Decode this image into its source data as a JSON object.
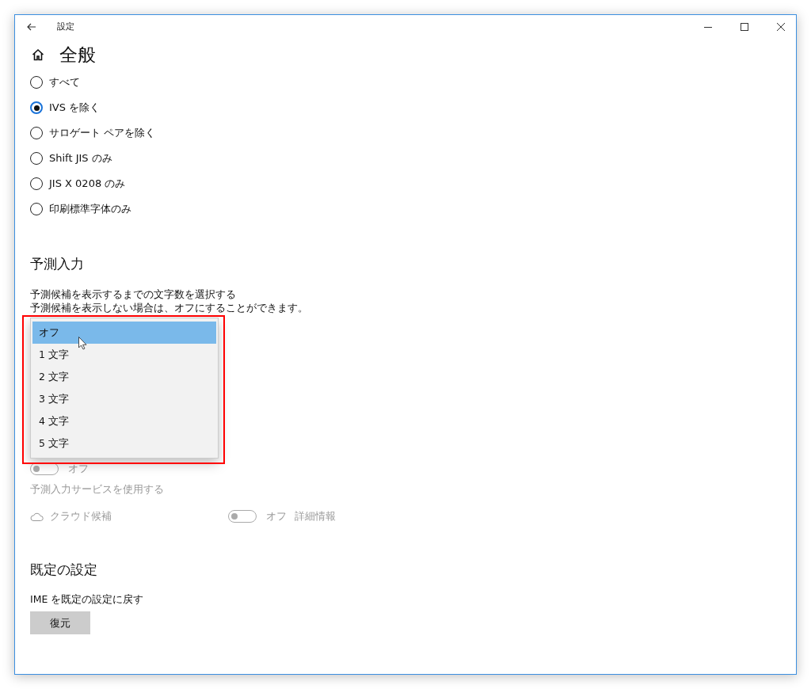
{
  "window": {
    "title": "設定"
  },
  "page": {
    "title": "全般"
  },
  "radio_options": [
    {
      "label": "すべて",
      "selected": false
    },
    {
      "label": "IVS を除く",
      "selected": true
    },
    {
      "label": "サロゲート ペアを除く",
      "selected": false
    },
    {
      "label": "Shift JIS のみ",
      "selected": false
    },
    {
      "label": "JIS X 0208 のみ",
      "selected": false
    },
    {
      "label": "印刷標準字体のみ",
      "selected": false
    }
  ],
  "predictive": {
    "heading": "予測入力",
    "description": [
      "予測候補を表示するまでの文字数を選択する",
      "予測候補を表示しない場合は、オフにすることができます。"
    ],
    "dropdown": {
      "expanded": true,
      "options": [
        {
          "label": "オフ",
          "selected": true
        },
        {
          "label": "1 文字",
          "selected": false
        },
        {
          "label": "2 文字",
          "selected": false
        },
        {
          "label": "3 文字",
          "selected": false
        },
        {
          "label": "4 文字",
          "selected": false
        },
        {
          "label": "5 文字",
          "selected": false
        }
      ]
    },
    "toggle": {
      "on": false,
      "label": "オフ"
    },
    "service_label": "予測入力サービスを使用する",
    "cloud": {
      "label": "クラウド候補",
      "disabled": true,
      "toggle": {
        "on": false,
        "label": "オフ"
      },
      "link": "詳細情報"
    }
  },
  "defaults": {
    "heading": "既定の設定",
    "description": "IME を既定の設定に戻す",
    "button": "復元"
  }
}
